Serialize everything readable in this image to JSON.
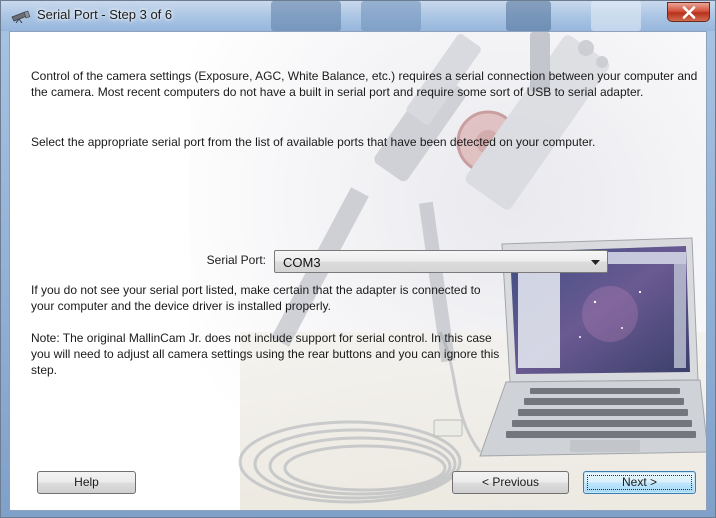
{
  "window": {
    "title": "Serial Port - Step 3 of 6"
  },
  "content": {
    "intro": "Control of the camera settings (Exposure, AGC, White Balance, etc.) requires a serial connection between your computer and the camera. Most recent computers do not have a built in serial port and require some sort of USB to serial adapter.",
    "instruction": "Select the appropriate serial port from the list of available ports that have been detected on your computer.",
    "serial_port_label": "Serial Port:",
    "serial_port_value": "COM3",
    "troubleshoot": "If you do not see your serial port listed, make certain that the adapter is connected to your computer and the device driver is installed properly.",
    "note": "Note: The original MallinCam Jr. does not include support for serial control. In this case you will need to adjust all camera settings using the rear buttons and you can ignore this step."
  },
  "buttons": {
    "help": "Help",
    "previous": "< Previous",
    "next": "Next >"
  },
  "icons": {
    "close": "close-icon",
    "app": "telescope-icon",
    "dropdown": "chevron-down-icon"
  },
  "colors": {
    "title_bar": "#a9c4e3",
    "close_button": "#c94a33",
    "default_button": "#bee6fd"
  }
}
